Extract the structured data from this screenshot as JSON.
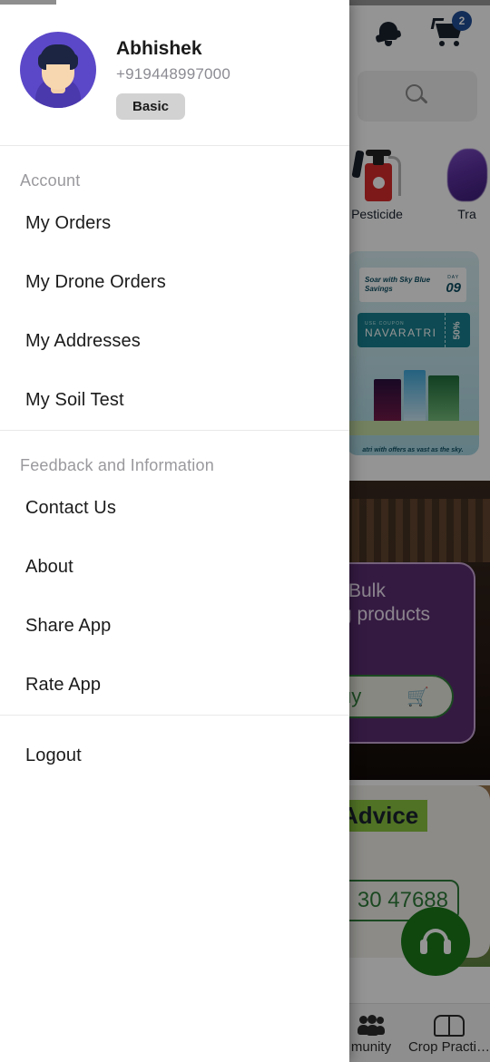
{
  "drawer": {
    "profile": {
      "avatar_icon": "user-avatar-male",
      "name": "Abhishek",
      "phone": "+919448997000",
      "plan_badge": "Basic"
    },
    "sections": [
      {
        "title": "Account",
        "items": [
          {
            "label": "My Orders"
          },
          {
            "label": "My Drone Orders"
          },
          {
            "label": "My Addresses"
          },
          {
            "label": "My Soil Test"
          }
        ]
      },
      {
        "title": "Feedback and Information",
        "items": [
          {
            "label": "Contact Us"
          },
          {
            "label": "About"
          },
          {
            "label": "Share App"
          },
          {
            "label": "Rate App"
          }
        ]
      }
    ],
    "logout": {
      "label": "Logout"
    }
  },
  "background": {
    "topbar": {
      "notification_icon": "bell-icon",
      "cart_icon": "shopping-cart-icon",
      "cart_badge": "2"
    },
    "search": {
      "icon": "search-icon"
    },
    "categories": [
      {
        "icon": "pesticide-sprayer-icon",
        "label": "Pesticide"
      },
      {
        "icon": "trap-icon",
        "label": "Tra"
      }
    ],
    "banner": {
      "headline": "Soar with Sky Blue Savings",
      "day_label": "DAY",
      "day_value": "09",
      "coupon_small": "USE COUPON",
      "coupon_code": "NAVARATRI",
      "coupon_discount": "50%",
      "footer": "atri with offers as vast as the sky."
    },
    "bulk_card": {
      "line1": "Bulk",
      "line2": "g products",
      "button_label": "uy",
      "button_icon": "cart-icon"
    },
    "advice_card": {
      "title": "Advice",
      "phone": "30 47688"
    },
    "support_fab": {
      "icon": "headphones-icon"
    },
    "bottom_nav": [
      {
        "icon": "community-people-icon",
        "label": "munity"
      },
      {
        "icon": "book-icon",
        "label": "Crop Practi…"
      }
    ]
  },
  "colors": {
    "avatar_bg": "#5b48c8",
    "badge_bg": "#d2d2d2",
    "cart_badge_bg": "#1f4e96",
    "support_fab_bg": "#1a7a1a",
    "advice_highlight": "#8bc53f",
    "bulk_card_bg": "#5b2d70",
    "scrim": "rgba(0,0,0,0.42)"
  }
}
